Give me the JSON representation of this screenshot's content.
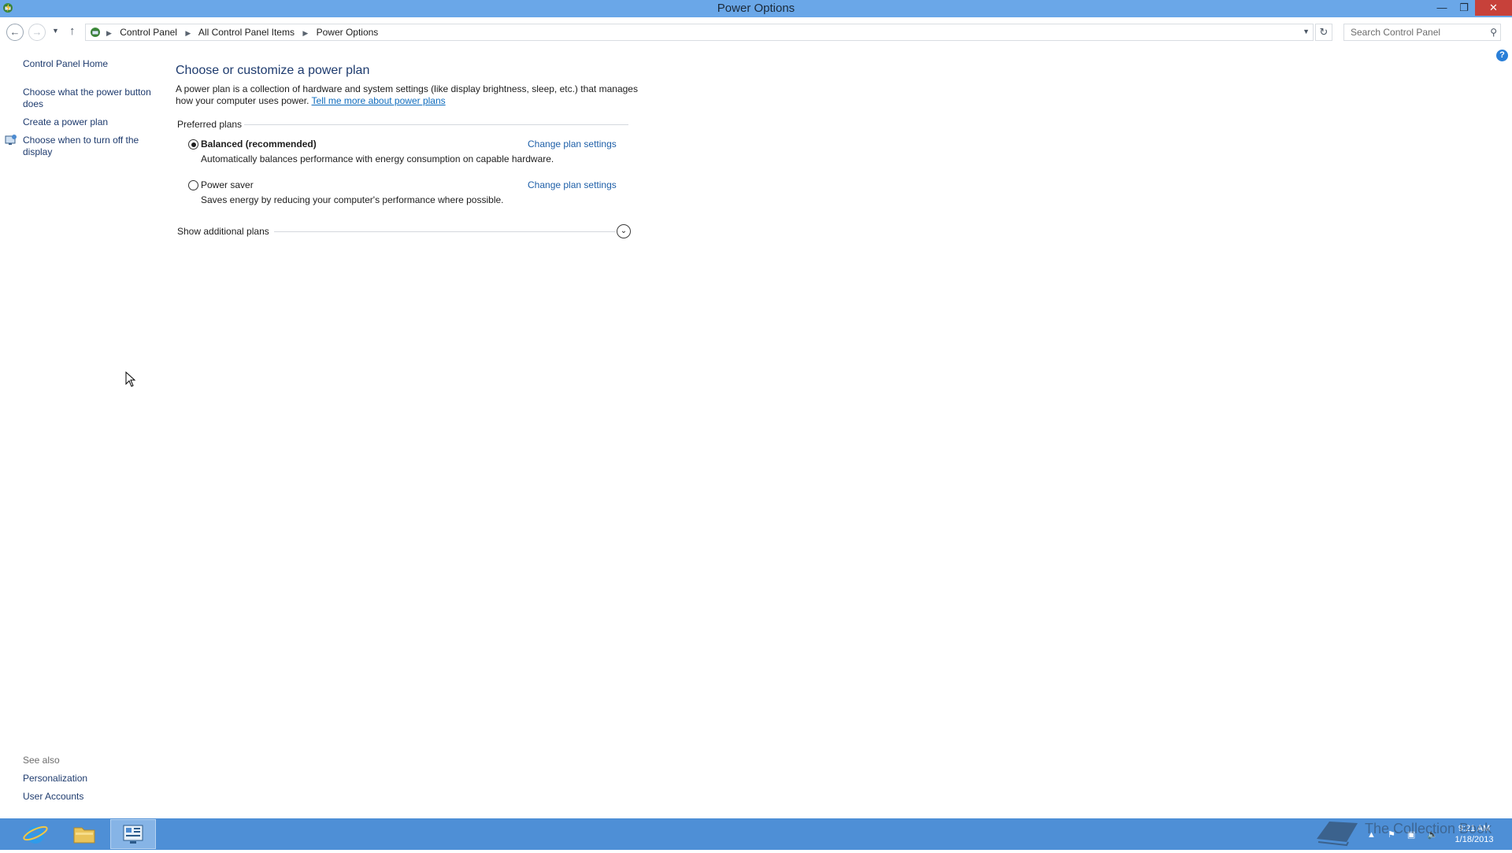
{
  "window": {
    "title": "Power Options"
  },
  "address": {
    "crumbs": [
      "Control Panel",
      "All Control Panel Items",
      "Power Options"
    ],
    "search_placeholder": "Search Control Panel"
  },
  "left_pane": {
    "home": "Control Panel Home",
    "links": [
      "Choose what the power button does",
      "Create a power plan",
      "Choose when to turn off the display"
    ],
    "see_also_label": "See also",
    "see_also": [
      "Personalization",
      "User Accounts"
    ]
  },
  "main": {
    "heading": "Choose or customize a power plan",
    "intro": "A power plan is a collection of hardware and system settings (like display brightness, sleep, etc.) that manages how your computer uses power.",
    "intro_link": "Tell me more about power plans",
    "group_label": "Preferred plans",
    "plans": [
      {
        "name": "Balanced (recommended)",
        "description": "Automatically balances performance with energy consumption on capable hardware.",
        "change_label": "Change plan settings",
        "selected": true
      },
      {
        "name": "Power saver",
        "description": "Saves energy by reducing your computer's performance where possible.",
        "change_label": "Change plan settings",
        "selected": false
      }
    ],
    "show_more": "Show additional plans"
  },
  "taskbar": {
    "time": "9:21 AM",
    "date": "1/18/2013",
    "watermark": "The Collection Book"
  },
  "colors": {
    "titlebar": "#6aa7e8",
    "taskbar": "#4e8fd6",
    "link": "#1e3b6e",
    "accent_link": "#0f6cbd",
    "close": "#c7413a"
  }
}
